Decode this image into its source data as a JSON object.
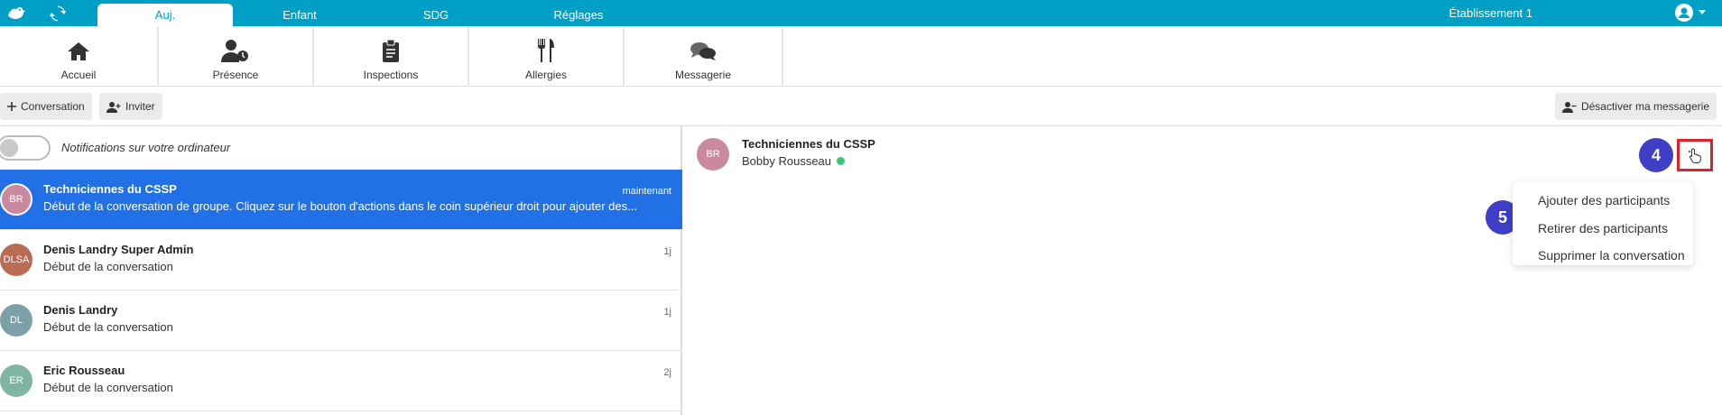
{
  "topbar": {
    "tabs": [
      "Auj.",
      "Enfant",
      "SDG",
      "Réglages"
    ],
    "establishment": "Établissement 1"
  },
  "modules": [
    "Accueil",
    "Présence",
    "Inspections",
    "Allergies",
    "Messagerie"
  ],
  "toolbar": {
    "new_conversation": "Conversation",
    "invite": "Inviter",
    "disable_messaging": "Désactiver ma messagerie"
  },
  "notifications": {
    "label": "Notifications sur votre ordinateur"
  },
  "conversations": [
    {
      "initials": "BR",
      "name": "Techniciennes du CSSP",
      "preview": "Début de la conversation de groupe. Cliquez sur le bouton d'actions dans le coin supérieur droit pour ajouter des...",
      "time": "maintenant",
      "avatar_color": "#c9899e"
    },
    {
      "initials": "DLSA",
      "name": "Denis Landry Super Admin",
      "preview": "Début de la conversation",
      "time": "1j",
      "avatar_color": "#b96b54"
    },
    {
      "initials": "DL",
      "name": "Denis Landry",
      "preview": "Début de la conversation",
      "time": "1j",
      "avatar_color": "#7ba0a8"
    },
    {
      "initials": "ER",
      "name": "Eric Rousseau",
      "preview": "Début de la conversation",
      "time": "2j",
      "avatar_color": "#7fb5a1"
    }
  ],
  "chat": {
    "initials": "BR",
    "title": "Techniciennes du CSSP",
    "participant": "Bobby Rousseau"
  },
  "step_badges": [
    "4",
    "5"
  ],
  "actions_menu": [
    "Ajouter des participants",
    "Retirer des participants",
    "Supprimer la conversation"
  ],
  "colors": {
    "topbar": "#00a0c6",
    "selected": "#2170e6",
    "badge": "#3e3ec7",
    "highlight": "#e0202a",
    "online": "#2ecc71"
  }
}
